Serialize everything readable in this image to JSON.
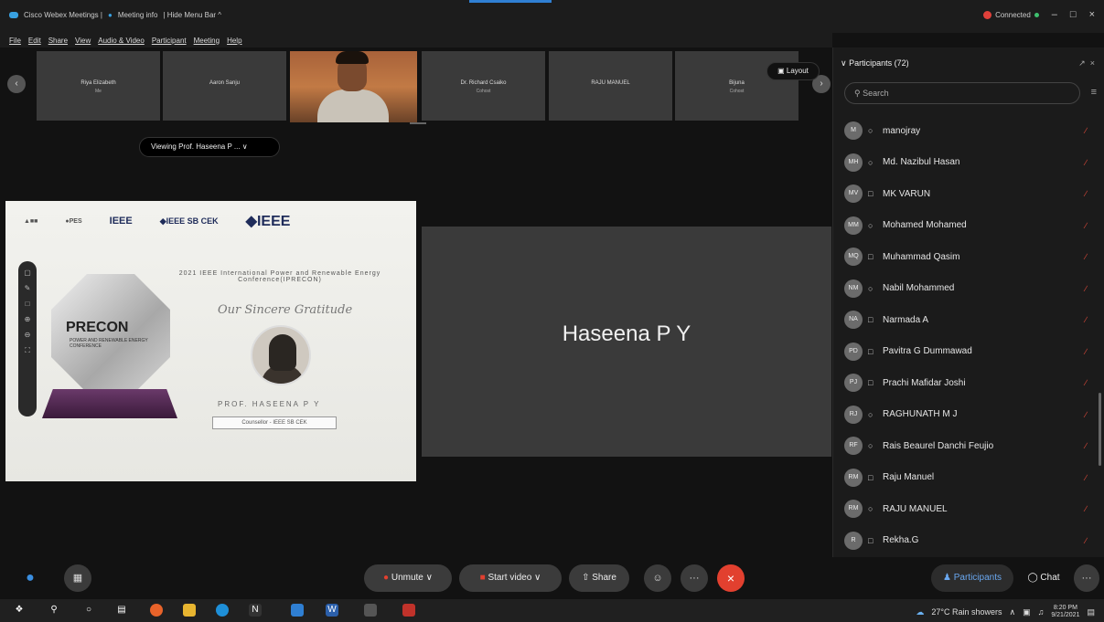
{
  "titlebar": {
    "app": "Cisco Webex Meetings |",
    "meeting_info": "Meeting info",
    "hide_menu": "| Hide Menu Bar ^",
    "status": "Connected",
    "ctrl_min": "–",
    "ctrl_max": "□",
    "ctrl_close": "×"
  },
  "menu": [
    "File",
    "Edit",
    "Share",
    "View",
    "Audio & Video",
    "Participant",
    "Meeting",
    "Help"
  ],
  "filmstrip": {
    "tiles": [
      {
        "name": "Riya Elizabeth",
        "sub": "Me"
      },
      {
        "name": "Aaron Sanju",
        "sub": ""
      },
      {
        "name": "Dr. Richard Csaiko",
        "sub": "Cohost"
      },
      {
        "name": "RAJU MANUEL",
        "sub": ""
      },
      {
        "name": "Bijuna",
        "sub": "Cohost"
      }
    ],
    "layout": "Layout"
  },
  "viewing": "Viewing Prof. Haseena P ...  ∨",
  "shared": {
    "logo1": "IEEE",
    "logo2": "◆IEEE SB CEK",
    "logo3": "◆IEEE",
    "conference": "2021 IEEE International Power and Renewable Energy Conference(IPRECON)",
    "gratitude": "Our Sincere Gratitude",
    "trophy": "PRECON",
    "trophy_sub": "POWER AND RENEWABLE ENERGY CONFERENCE",
    "prof": "PROF. HASEENA P Y",
    "role": "Counsellor - IEEE SB CEK"
  },
  "speaker": {
    "name": "Haseena P Y"
  },
  "panel": {
    "title": "Participants (72)",
    "search_placeholder": "Search",
    "participants": [
      {
        "initials": "M",
        "name": "manojray",
        "icon": "○"
      },
      {
        "initials": "MH",
        "name": "Md. Nazibul Hasan",
        "icon": "○"
      },
      {
        "initials": "MV",
        "name": "MK VARUN",
        "icon": "□"
      },
      {
        "initials": "MM",
        "name": "Mohamed Mohamed",
        "icon": "○"
      },
      {
        "initials": "MQ",
        "name": "Muhammad Qasim",
        "icon": "□"
      },
      {
        "initials": "NM",
        "name": "Nabil Mohammed",
        "icon": "○"
      },
      {
        "initials": "NA",
        "name": "Narmada A",
        "icon": "□"
      },
      {
        "initials": "PD",
        "name": "Pavitra G Dummawad",
        "icon": "□"
      },
      {
        "initials": "PJ",
        "name": "Prachi Mafidar Joshi",
        "icon": "□"
      },
      {
        "initials": "RJ",
        "name": "RAGHUNATH M J",
        "icon": "○"
      },
      {
        "initials": "RF",
        "name": "Rais Beaurel Danchi Feujio",
        "icon": "○"
      },
      {
        "initials": "RM",
        "name": "Raju Manuel",
        "icon": "□"
      },
      {
        "initials": "RM",
        "name": "RAJU MANUEL",
        "icon": "○"
      },
      {
        "initials": "R",
        "name": "Rekha.G",
        "icon": "□"
      }
    ]
  },
  "bottom": {
    "unmute": "Unmute",
    "start_video": "Start video",
    "share": "Share",
    "participants": "Participants",
    "chat": "Chat",
    "more": "···",
    "end": "×"
  },
  "taskbar": {
    "weather": "27°C  Rain showers",
    "time": "8:20 PM",
    "date": "9/21/2021"
  }
}
